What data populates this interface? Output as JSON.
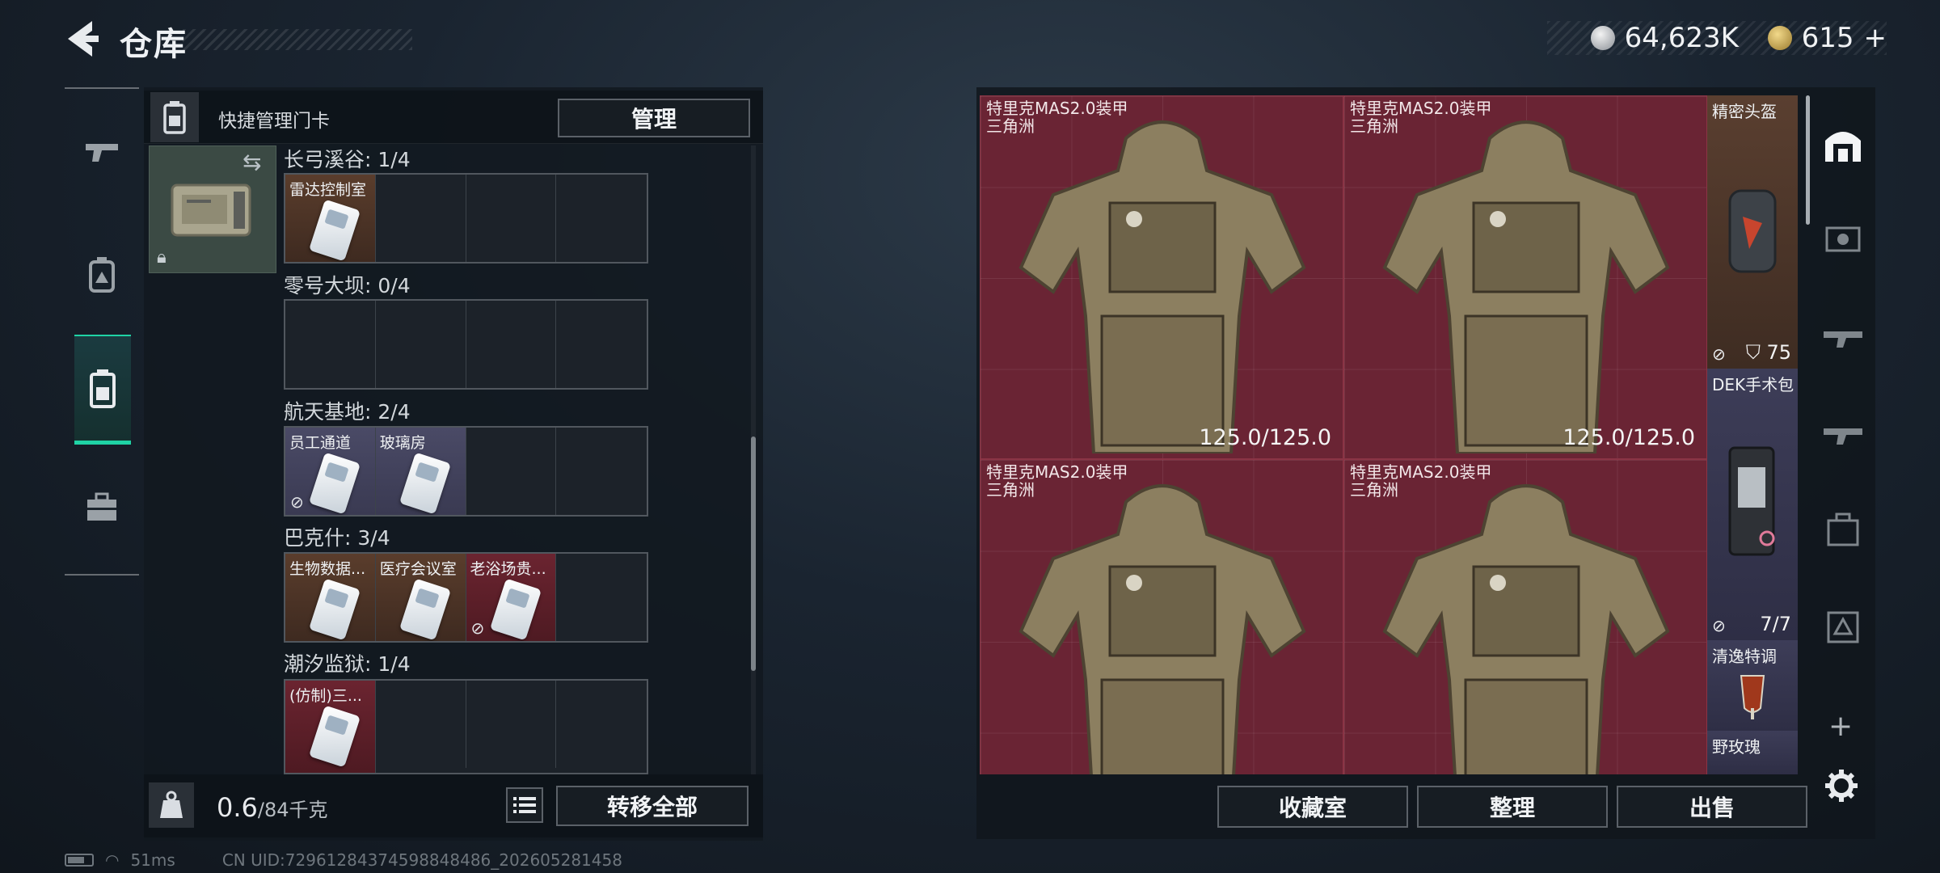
{
  "header": {
    "title": "仓库"
  },
  "currency": {
    "silver": "64,623K",
    "gold": "615",
    "gold_plus": "+"
  },
  "quick_manage": {
    "label": "快捷管理门卡",
    "manage_button": "管理"
  },
  "keycard_maps": [
    {
      "name": "长弓溪谷: 1/4",
      "color": "brown",
      "slots": [
        {
          "label": "雷达控制室",
          "nodrop": false
        }
      ]
    },
    {
      "name": "零号大坝: 0/4",
      "color": "",
      "slots": []
    },
    {
      "name": "航天基地: 2/4",
      "color": "purple",
      "slots": [
        {
          "label": "员工通道",
          "nodrop": true
        },
        {
          "label": "玻璃房",
          "nodrop": false
        }
      ]
    },
    {
      "name": "巴克什: 3/4",
      "color": "brown",
      "slots": [
        {
          "label": "生物数据...",
          "nodrop": false
        },
        {
          "label": "医疗会议室",
          "nodrop": false
        },
        {
          "label": "老浴场贵...",
          "nodrop": true
        }
      ]
    },
    {
      "name": "潮汐监狱: 1/4",
      "color": "red",
      "slots": [
        {
          "label": "(仿制)三...",
          "nodrop": false
        }
      ]
    }
  ],
  "footer": {
    "weight_value": "0.6",
    "weight_max": "/84千克",
    "transfer_all": "转移全部"
  },
  "stash": {
    "armors": [
      {
        "name": "特里克MAS2.0装甲",
        "sub": "三角洲",
        "durability": "125.0/125.0"
      },
      {
        "name": "特里克MAS2.0装甲",
        "sub": "三角洲",
        "durability": "125.0/125.0"
      },
      {
        "name": "特里克MAS2.0装甲",
        "sub": "三角洲",
        "durability": ""
      },
      {
        "name": "特里克MAS2.0装甲",
        "sub": "三角洲",
        "durability": ""
      }
    ],
    "side_items": [
      {
        "name": "精密头盔",
        "stat": "75"
      },
      {
        "name": "DEK手术包",
        "stat": "7/7"
      },
      {
        "name": "清逸特调",
        "stat": ""
      },
      {
        "name": "野玫瑰",
        "stat": ""
      }
    ]
  },
  "bottom_buttons": {
    "collection": "收藏室",
    "organize": "整理",
    "sell": "出售"
  },
  "status": {
    "ping": "51ms",
    "uid": "CN UID:7296128437459884848​6_202605281458"
  },
  "colors": {
    "accent": "#1fd3a5",
    "armor_bg": "#6a2434"
  }
}
